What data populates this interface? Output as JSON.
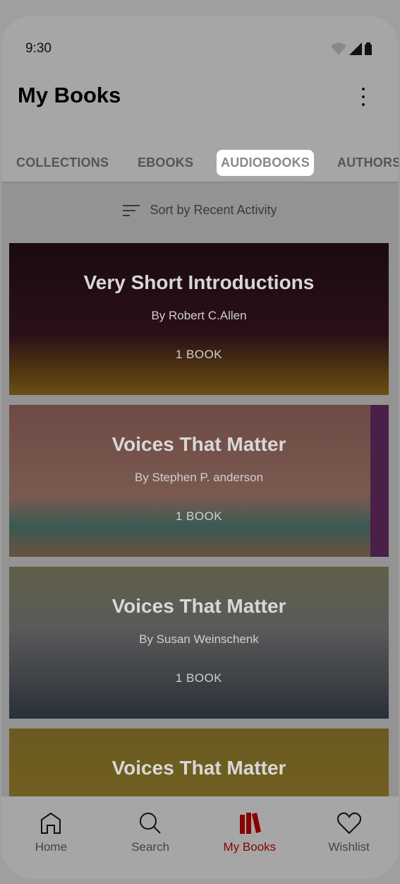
{
  "status": {
    "time": "9:30"
  },
  "header": {
    "title": "My Books"
  },
  "tabs": [
    {
      "label": "COLLECTIONS"
    },
    {
      "label": "EBOOKS"
    },
    {
      "label": "AUDIOBOOKS",
      "active": true
    },
    {
      "label": "AUTHORS"
    }
  ],
  "sort": {
    "label": "Sort by Recent Activity"
  },
  "cards": [
    {
      "title": "Very Short Introductions",
      "author": "By Robert C.Allen",
      "count": "1 BOOK"
    },
    {
      "title": "Voices That Matter",
      "author": "By Stephen P. anderson",
      "count": "1 BOOK"
    },
    {
      "title": "Voices That Matter",
      "author": "By Susan Weinschenk",
      "count": "1 BOOK"
    },
    {
      "title": "Voices That Matter",
      "author": "",
      "count": ""
    }
  ],
  "nav": [
    {
      "label": "Home",
      "icon": "home-icon"
    },
    {
      "label": "Search",
      "icon": "search-icon"
    },
    {
      "label": "My Books",
      "icon": "books-icon",
      "active": true
    },
    {
      "label": "Wishlist",
      "icon": "heart-icon"
    }
  ],
  "colors": {
    "accent": "#8a0000",
    "highlight": "#ffffff"
  }
}
